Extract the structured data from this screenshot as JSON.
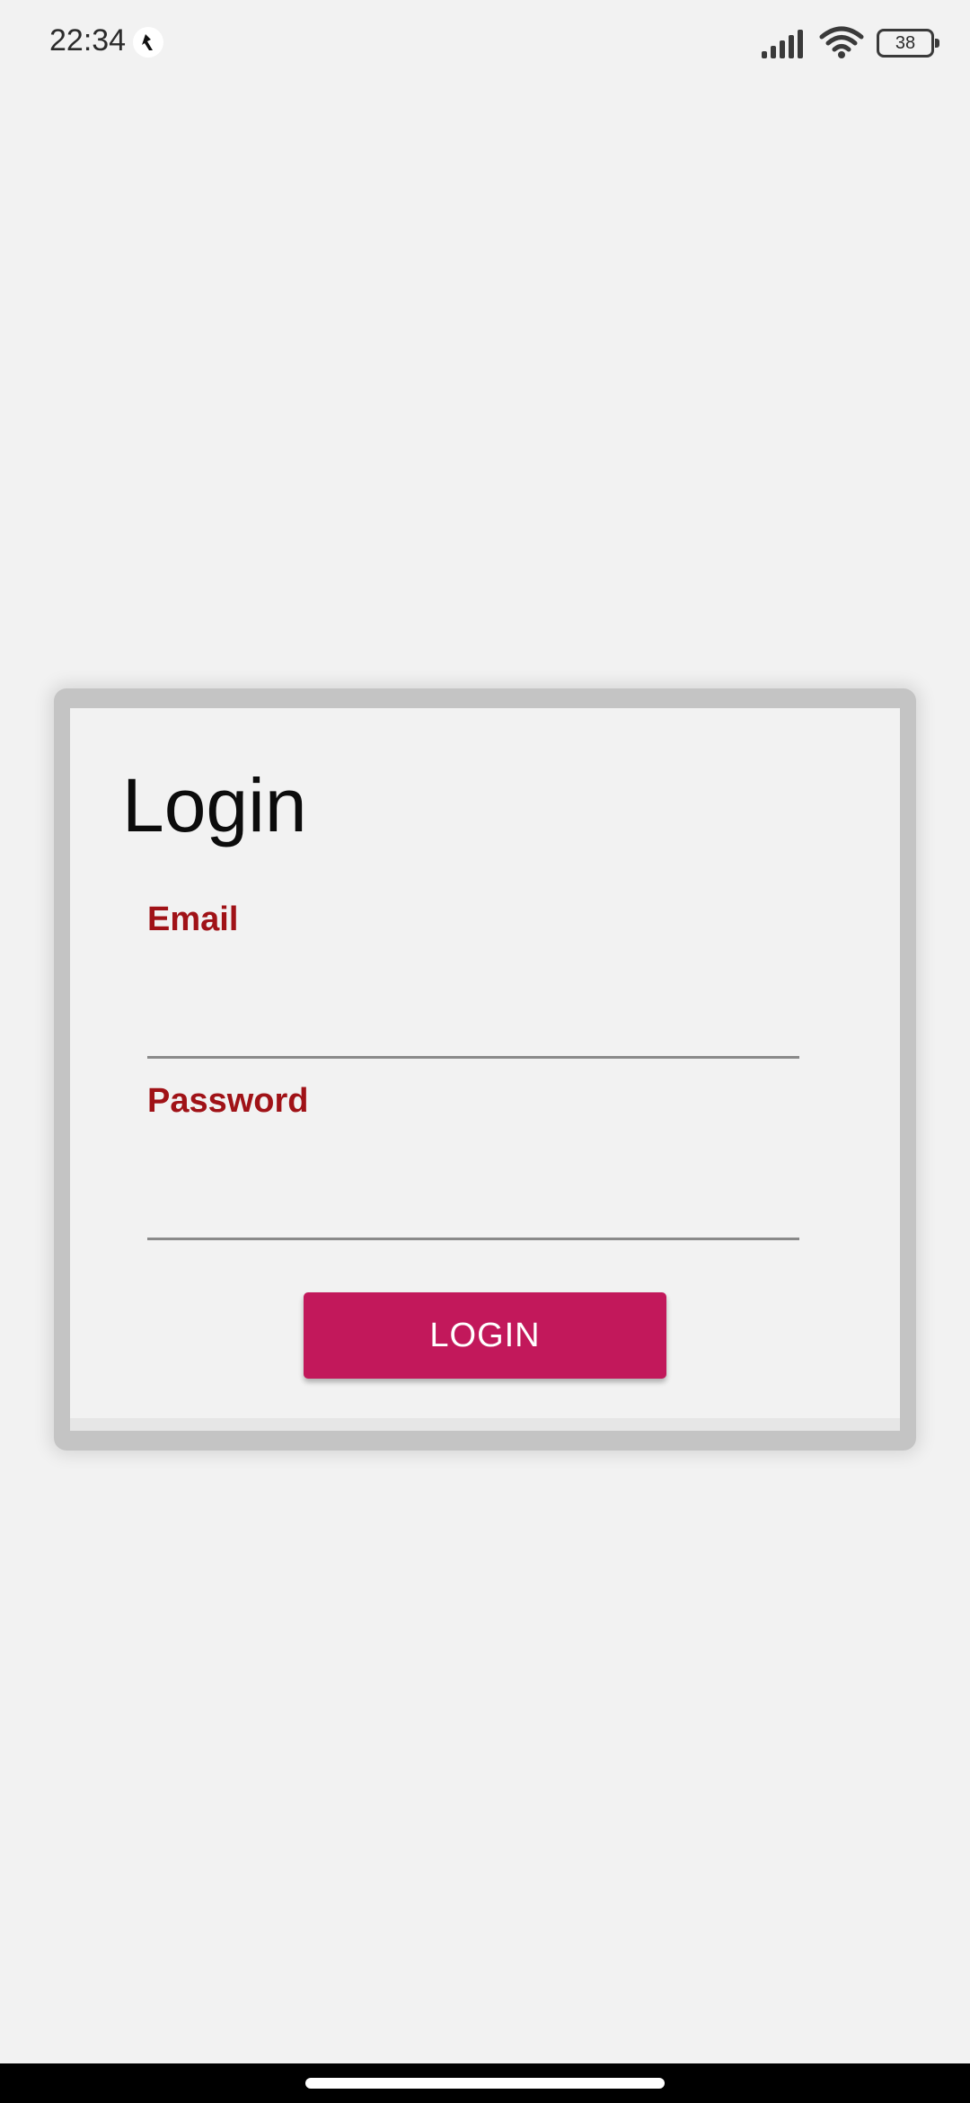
{
  "status_bar": {
    "time": "22:34",
    "battery_level": "38",
    "app_icon": "app-notification-icon",
    "signal_icon": "cellular-signal-icon",
    "wifi_icon": "wifi-icon"
  },
  "login_form": {
    "title": "Login",
    "email_label": "Email",
    "email_value": "",
    "password_label": "Password",
    "password_value": "",
    "submit_label": "LOGIN"
  },
  "colors": {
    "background": "#f2f2f2",
    "label_color": "#a01217",
    "button_color": "#c2185b",
    "card_border": "#c4c4c4"
  }
}
